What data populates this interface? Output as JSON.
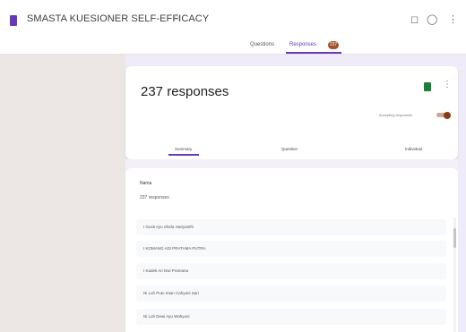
{
  "header": {
    "title": "SMASTA KUESIONER SELF-EFFICACY",
    "icons": [
      "doc-icon",
      "star-icon",
      "palette-icon",
      "settings-icon",
      "more-icon"
    ],
    "accent_color": "#673ab7"
  },
  "tabs": [
    {
      "label": "Questions"
    },
    {
      "label": "Responses",
      "count": "237"
    }
  ],
  "responses_card": {
    "title": "237 responses",
    "accepting_label": "Accepting responses",
    "accepting": true,
    "subtabs": [
      "Summary",
      "Question",
      "Individual"
    ]
  },
  "question": {
    "title": "Nama",
    "count": "237 responses",
    "answers": [
      "I Gusti Ayu Shela Hariyanthi",
      "I KOMANG ADI PRATAMA PUTRA",
      "I Kadek Ari Dwi Pramana",
      "Ni Luh Putu Intan Cahyani Sari",
      "Ni Luh Dewi Ayu Wahyuni"
    ]
  }
}
